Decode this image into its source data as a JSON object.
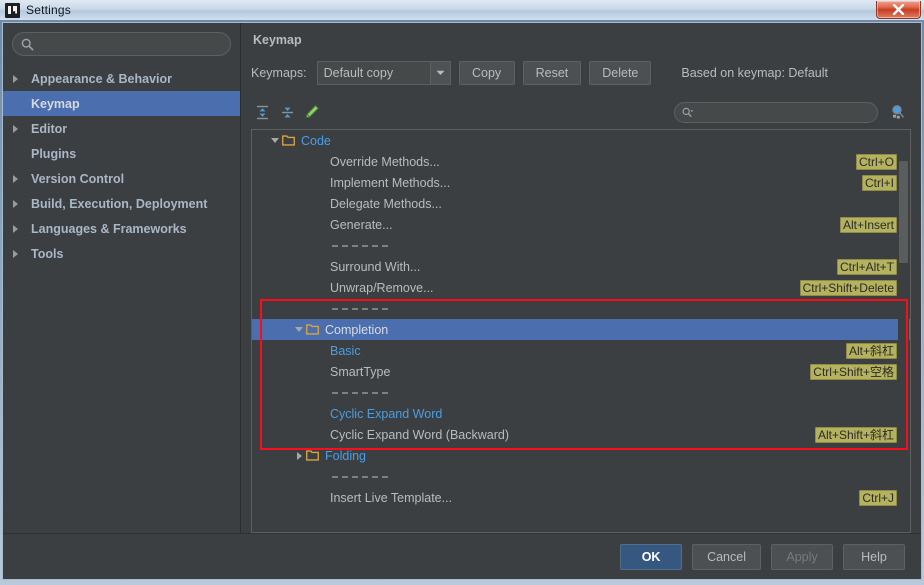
{
  "window": {
    "title": "Settings",
    "app_icon": "intellij-idea-icon",
    "close_label": "x"
  },
  "sidebar": {
    "search": {
      "value": "",
      "placeholder": ""
    },
    "items": [
      {
        "label": "Appearance & Behavior",
        "expandable": true,
        "selected": false
      },
      {
        "label": "Keymap",
        "expandable": false,
        "selected": true
      },
      {
        "label": "Editor",
        "expandable": true,
        "selected": false
      },
      {
        "label": "Plugins",
        "expandable": false,
        "selected": false
      },
      {
        "label": "Version Control",
        "expandable": true,
        "selected": false
      },
      {
        "label": "Build, Execution, Deployment",
        "expandable": true,
        "selected": false
      },
      {
        "label": "Languages & Frameworks",
        "expandable": true,
        "selected": false
      },
      {
        "label": "Tools",
        "expandable": true,
        "selected": false
      }
    ]
  },
  "main": {
    "title": "Keymap",
    "keymaps_label": "Keymaps:",
    "keymap_selected": "Default copy",
    "buttons": {
      "copy": "Copy",
      "reset": "Reset",
      "delete": "Delete"
    },
    "based_on": "Based on keymap: Default",
    "toolbar": {
      "expand_all": "expand-all-icon",
      "collapse_all": "collapse-all-icon",
      "edit": "edit-pencil-icon",
      "find_actions": "find-actions-by-shortcut-icon"
    },
    "filter": {
      "value": "",
      "placeholder": ""
    }
  },
  "tree": {
    "rows": [
      {
        "type": "folder",
        "label": "Code",
        "indent": 0,
        "arrow": "down",
        "shortcut": "",
        "style": "folder",
        "selected": false
      },
      {
        "type": "item",
        "label": "Override Methods...",
        "indent": 2,
        "arrow": "none",
        "shortcut": "Ctrl+O",
        "style": "normal",
        "selected": false
      },
      {
        "type": "item",
        "label": "Implement Methods...",
        "indent": 2,
        "arrow": "none",
        "shortcut": "Ctrl+I",
        "style": "normal",
        "selected": false
      },
      {
        "type": "item",
        "label": "Delegate Methods...",
        "indent": 2,
        "arrow": "none",
        "shortcut": "",
        "style": "normal",
        "selected": false
      },
      {
        "type": "item",
        "label": "Generate...",
        "indent": 2,
        "arrow": "none",
        "shortcut": "Alt+Insert",
        "style": "normal",
        "selected": false
      },
      {
        "type": "separator",
        "label": "",
        "indent": 2,
        "arrow": "none",
        "shortcut": "",
        "style": "normal",
        "selected": false
      },
      {
        "type": "item",
        "label": "Surround With...",
        "indent": 2,
        "arrow": "none",
        "shortcut": "Ctrl+Alt+T",
        "style": "normal",
        "selected": false
      },
      {
        "type": "item",
        "label": "Unwrap/Remove...",
        "indent": 2,
        "arrow": "none",
        "shortcut": "Ctrl+Shift+Delete",
        "style": "normal",
        "selected": false
      },
      {
        "type": "separator",
        "label": "",
        "indent": 2,
        "arrow": "none",
        "shortcut": "",
        "style": "normal",
        "selected": false
      },
      {
        "type": "folder",
        "label": "Completion",
        "indent": 1,
        "arrow": "down",
        "shortcut": "",
        "style": "folder",
        "selected": true
      },
      {
        "type": "item",
        "label": "Basic",
        "indent": 2,
        "arrow": "none",
        "shortcut": "Alt+斜杠",
        "style": "blue",
        "selected": false
      },
      {
        "type": "item",
        "label": "SmartType",
        "indent": 2,
        "arrow": "none",
        "shortcut": "Ctrl+Shift+空格",
        "style": "normal",
        "selected": false
      },
      {
        "type": "separator",
        "label": "",
        "indent": 2,
        "arrow": "none",
        "shortcut": "",
        "style": "normal",
        "selected": false
      },
      {
        "type": "item",
        "label": "Cyclic Expand Word",
        "indent": 2,
        "arrow": "none",
        "shortcut": "",
        "style": "blue",
        "selected": false
      },
      {
        "type": "item",
        "label": "Cyclic Expand Word (Backward)",
        "indent": 2,
        "arrow": "none",
        "shortcut": "Alt+Shift+斜杠",
        "style": "normal",
        "selected": false
      },
      {
        "type": "folder",
        "label": "Folding",
        "indent": 1,
        "arrow": "right",
        "shortcut": "",
        "style": "folder",
        "selected": false
      },
      {
        "type": "separator",
        "label": "",
        "indent": 2,
        "arrow": "none",
        "shortcut": "",
        "style": "normal",
        "selected": false
      },
      {
        "type": "item",
        "label": "Insert Live Template...",
        "indent": 2,
        "arrow": "none",
        "shortcut": "Ctrl+J",
        "style": "normal",
        "selected": false
      }
    ],
    "annotation": {
      "color": "#fc0d1b",
      "shape": "rectangle"
    }
  },
  "footer": {
    "ok": "OK",
    "cancel": "Cancel",
    "apply": "Apply",
    "help": "Help"
  },
  "colors": {
    "selection_blue": "#4b6eaf",
    "panel_bg": "#3c3f41",
    "text": "#bbbbbb",
    "link_blue": "#4a9ee0",
    "shortcut_badge": "#b5b25e",
    "annotation_red": "#fc0d1b",
    "primary_button": "#365880"
  }
}
